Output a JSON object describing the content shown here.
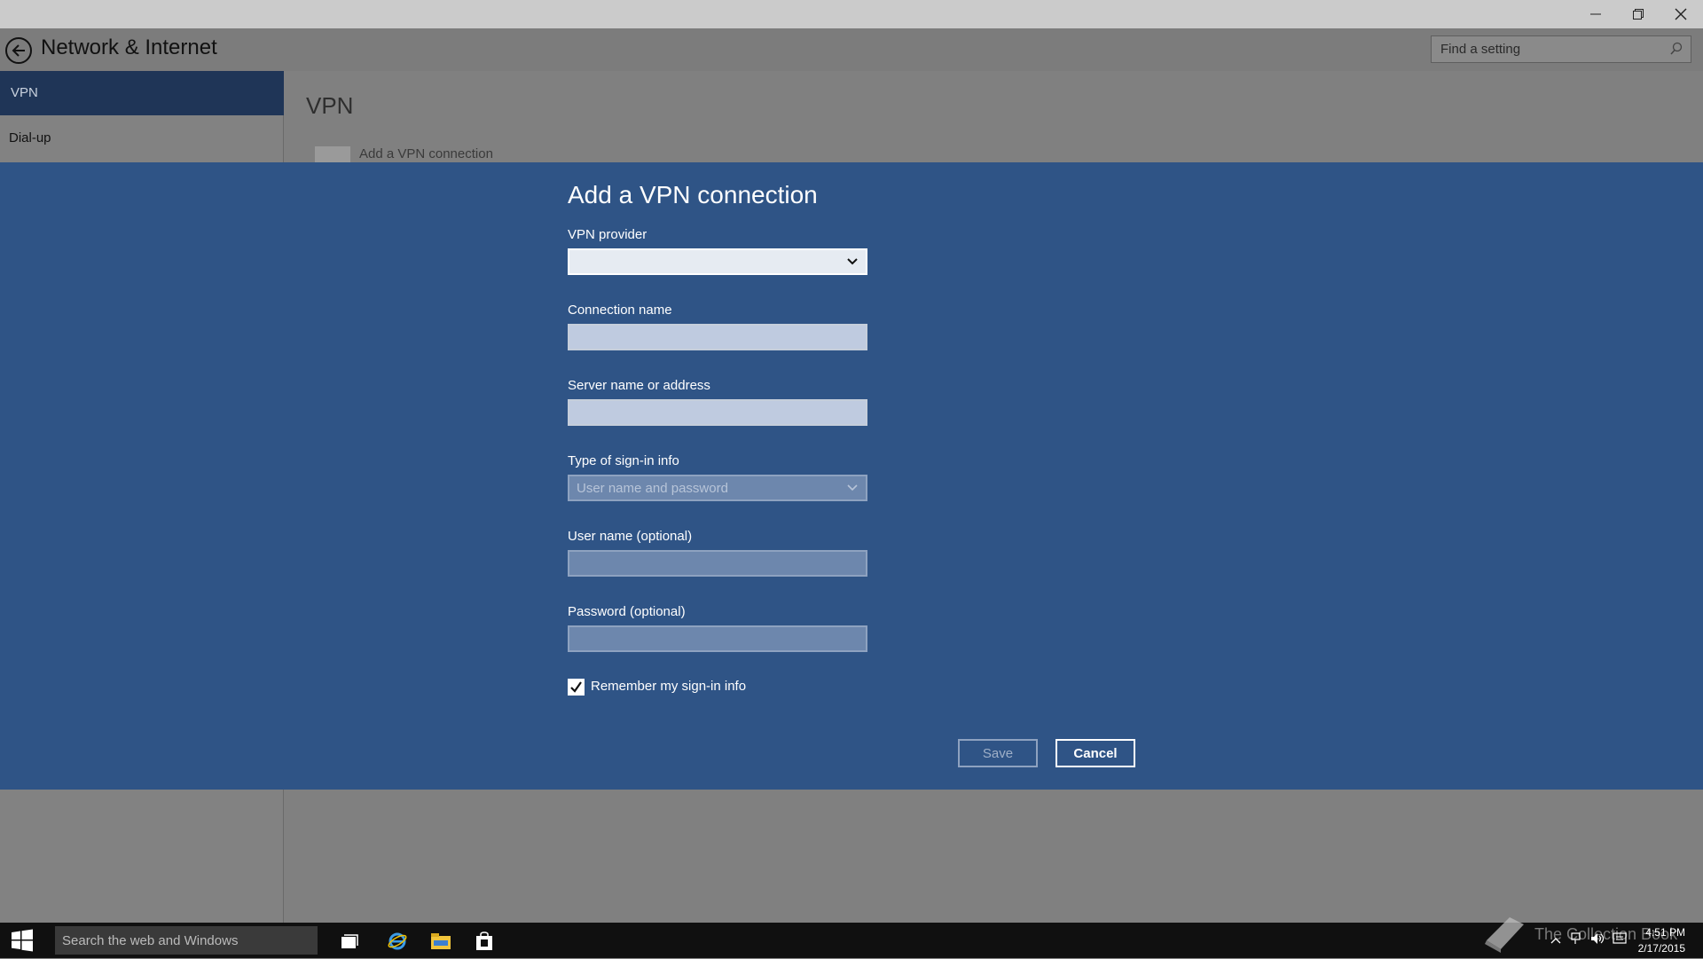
{
  "window": {
    "app_title": "Network & Internet",
    "search_placeholder": "Find a setting"
  },
  "sidebar": {
    "items": [
      {
        "label": "VPN",
        "selected": true
      },
      {
        "label": "Dial-up",
        "selected": false
      }
    ]
  },
  "main": {
    "title": "VPN",
    "add_vpn_label": "Add a VPN connection"
  },
  "dialog": {
    "title": "Add a VPN connection",
    "fields": {
      "vpn_provider_label": "VPN provider",
      "vpn_provider_value": "",
      "connection_name_label": "Connection name",
      "connection_name_value": "",
      "server_label": "Server name or address",
      "server_value": "",
      "signin_type_label": "Type of sign-in info",
      "signin_type_value": "User name and password",
      "username_label": "User name (optional)",
      "username_value": "",
      "password_label": "Password (optional)",
      "password_value": ""
    },
    "remember_label": "Remember my sign-in info",
    "remember_checked": true,
    "save_label": "Save",
    "cancel_label": "Cancel"
  },
  "taskbar": {
    "search_placeholder": "Search the web and Windows",
    "time": "4:51 PM",
    "date": "2/17/2015",
    "watermark": "The Collection Book"
  },
  "colors": {
    "dialog_bg": "#2f5486",
    "selected_nav": "#1f3557"
  }
}
